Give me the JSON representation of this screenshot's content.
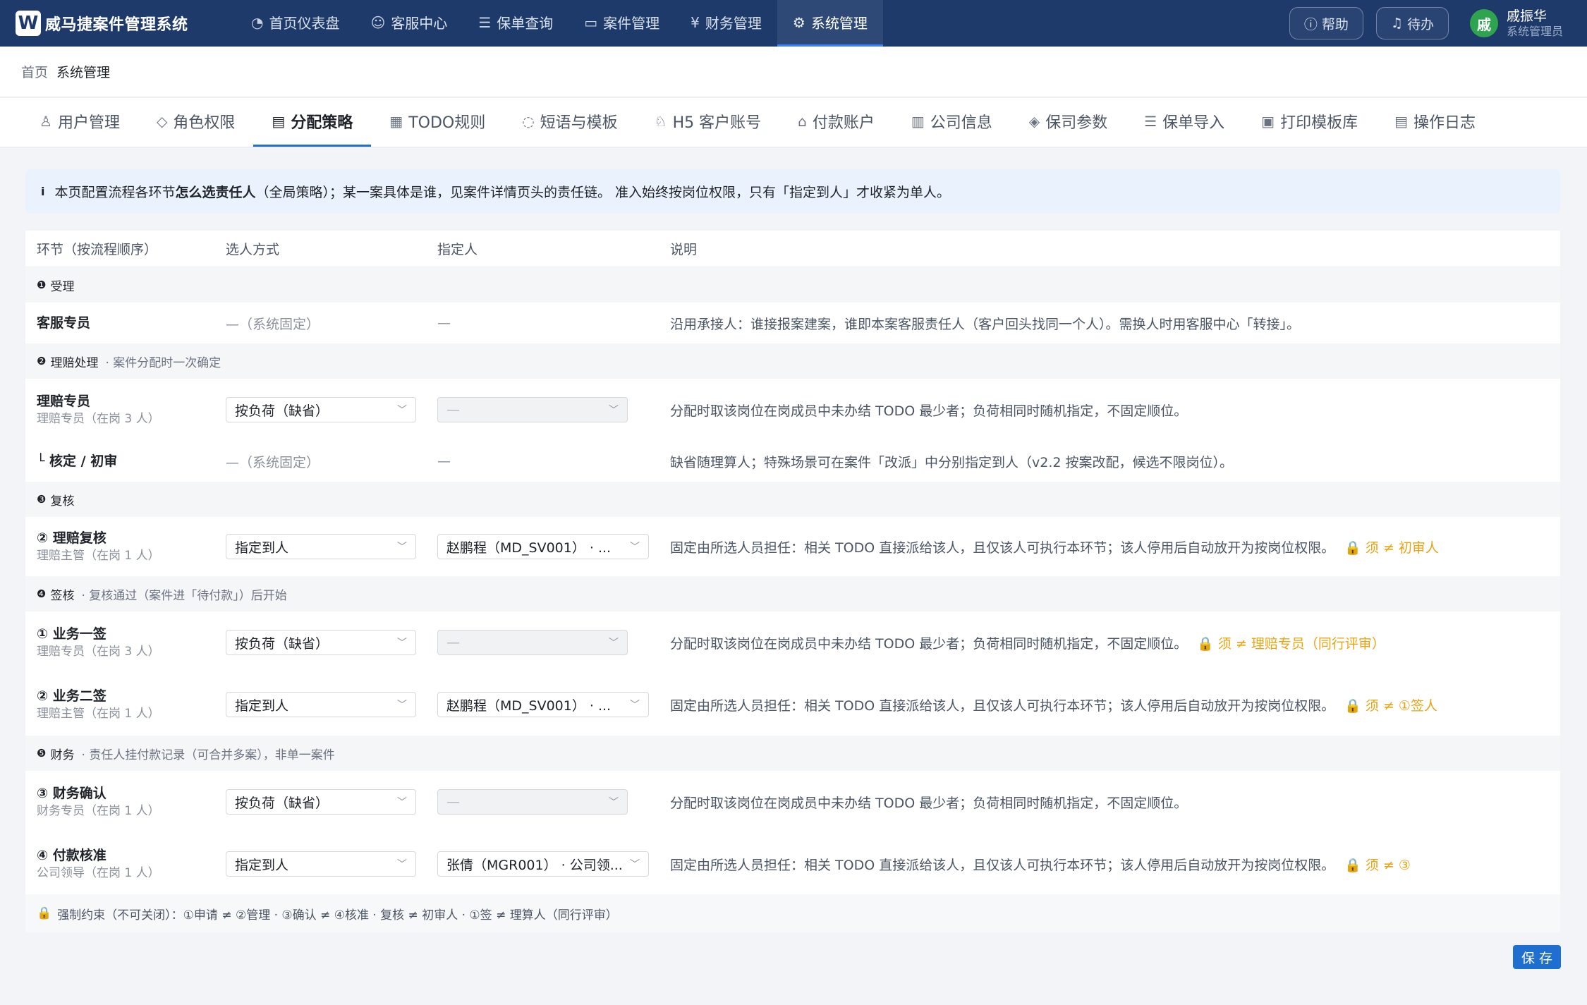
{
  "app": {
    "logo_letter": "W",
    "title": "威马捷案件管理系统"
  },
  "nav": [
    {
      "icon": "◔",
      "label": "首页仪表盘"
    },
    {
      "icon": "☺",
      "label": "客服中心"
    },
    {
      "icon": "☰",
      "label": "保单查询"
    },
    {
      "icon": "▭",
      "label": "案件管理"
    },
    {
      "icon": "¥",
      "label": "财务管理"
    },
    {
      "icon": "⚙",
      "label": "系统管理"
    }
  ],
  "top": {
    "help": "帮助",
    "todo": "待办",
    "avatar": "戚",
    "user_name": "戚振华",
    "user_role": "系统管理员"
  },
  "breadcrumb": {
    "home": "首页",
    "current": "系统管理"
  },
  "tabs": [
    {
      "icon": "♙",
      "label": "用户管理"
    },
    {
      "icon": "◇",
      "label": "角色权限"
    },
    {
      "icon": "▤",
      "label": "分配策略"
    },
    {
      "icon": "▦",
      "label": "TODO规则"
    },
    {
      "icon": "◌",
      "label": "短语与模板"
    },
    {
      "icon": "♘",
      "label": "H5 客户账号"
    },
    {
      "icon": "⌂",
      "label": "付款账户"
    },
    {
      "icon": "▥",
      "label": "公司信息"
    },
    {
      "icon": "◈",
      "label": "保司参数"
    },
    {
      "icon": "☰",
      "label": "保单导入"
    },
    {
      "icon": "▣",
      "label": "打印模板库"
    },
    {
      "icon": "▤",
      "label": "操作日志"
    }
  ],
  "banner": {
    "icon": "i",
    "pre": "本页配置流程各环节",
    "bold": "怎么选责任人",
    "post": "（全局策略）；某一案具体是谁，见案件详情页头的责任链。 准入始终按岗位权限，只有「指定到人」才收紧为单人。"
  },
  "table": {
    "headers": [
      "环节（按流程顺序）",
      "选人方式",
      "指定人",
      "说明"
    ],
    "groups": {
      "g1": {
        "num": "❶",
        "title": "受理",
        "note": ""
      },
      "g2": {
        "num": "❷",
        "title": "理赔处理",
        "note": "· 案件分配时一次确定"
      },
      "g3": {
        "num": "❸",
        "title": "复核",
        "note": ""
      },
      "g4": {
        "num": "❹",
        "title": "签核",
        "note": "· 复核通过（案件进「待付款」）后开始"
      },
      "g5": {
        "num": "❺",
        "title": "财务",
        "note": "· 责任人挂付款记录（可合并多案），非单一案件"
      }
    },
    "rows": {
      "r1": {
        "name": "客服专员",
        "sub": "",
        "method": "—（系统固定）",
        "assignee": "—",
        "desc": "沿用承接人：谁接报案建案，谁即本案客服责任人（客户回头找同一个人）。需换人时用客服中心「转接」。",
        "lock": ""
      },
      "r2": {
        "name": "理赔专员",
        "sub": "理赔专员（在岗 3 人）",
        "method": "按负荷（缺省）",
        "assignee": "—",
        "desc": "分配时取该岗位在岗成员中未办结 TODO 最少者；负荷相同时随机指定，不固定顺位。",
        "lock": ""
      },
      "r3": {
        "name": "└ 核定 / 初审",
        "sub": "",
        "method": "—（系统固定）",
        "assignee": "—",
        "desc": "缺省随理算人；特殊场景可在案件「改派」中分别指定到人（v2.2 按案改配，候选不限岗位）。",
        "lock": ""
      },
      "r4": {
        "name": "② 理赔复核",
        "sub": "理赔主管（在岗 1 人）",
        "method": "指定到人",
        "assignee": "赵鹏程（MD_SV001） · ...",
        "desc": "固定由所选人员担任：相关 TODO 直接派给该人，且仅该人可执行本环节；该人停用后自动放开为按岗位权限。",
        "lock": "🔒 须 ≠ 初审人"
      },
      "r5": {
        "name": "① 业务一签",
        "sub": "理赔专员（在岗 3 人）",
        "method": "按负荷（缺省）",
        "assignee": "—",
        "desc": "分配时取该岗位在岗成员中未办结 TODO 最少者；负荷相同时随机指定，不固定顺位。",
        "lock": "🔒 须 ≠ 理赔专员（同行评审）"
      },
      "r6": {
        "name": "② 业务二签",
        "sub": "理赔主管（在岗 1 人）",
        "method": "指定到人",
        "assignee": "赵鹏程（MD_SV001） · ...",
        "desc": "固定由所选人员担任：相关 TODO 直接派给该人，且仅该人可执行本环节；该人停用后自动放开为按岗位权限。",
        "lock": "🔒 须 ≠ ①签人"
      },
      "r7": {
        "name": "③ 财务确认",
        "sub": "财务专员（在岗 1 人）",
        "method": "按负荷（缺省）",
        "assignee": "—",
        "desc": "分配时取该岗位在岗成员中未办结 TODO 最少者；负荷相同时随机指定，不固定顺位。",
        "lock": ""
      },
      "r8": {
        "name": "④ 付款核准",
        "sub": "公司领导（在岗 1 人）",
        "method": "指定到人",
        "assignee": "张倩（MGR001） · 公司领...",
        "desc": "固定由所选人员担任：相关 TODO 直接派给该人，且仅该人可执行本环节；该人停用后自动放开为按岗位权限。",
        "lock": "🔒 须 ≠ ③"
      }
    }
  },
  "constraint": {
    "icon": "🔒",
    "text": "强制约束（不可关闭）：①申请 ≠ ②管理 · ③确认 ≠ ④核准 · 复核 ≠ 初审人 · ①签 ≠ 理算人（同行评审）"
  },
  "save_label": "保 存",
  "colors": {
    "nav_bg": "#1e3a6b",
    "accent": "#1f6fd1",
    "warn": "#e8a415",
    "banner_bg": "#eaf3fd"
  }
}
